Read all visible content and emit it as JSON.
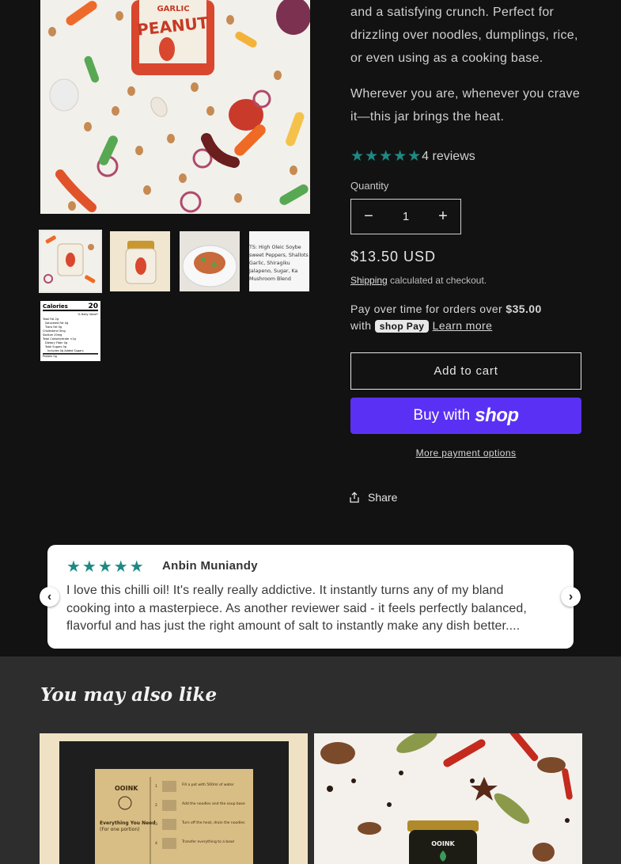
{
  "gallery": {
    "main_alt_text_on_jar_top": "GARLIC",
    "main_alt_text_on_jar": "PEANUT",
    "thumb4_text": "TS: High Oleic Soybe... sweet Peppers, Shallots, Garlic, Shiragiku Jalapeno, Sugar, Ka... Mushroom Blend",
    "nutrition": {
      "heading": "Calories",
      "calories": "20",
      "dv": "% Daily Value*",
      "rows": [
        "Total Fat 2g",
        "Saturated Fat 0g",
        "Trans Fat 0g",
        "Cholesterol 0mg",
        "Sodium 20mg",
        "Total Carbohydrate <1g",
        "Dietary Fiber 0g",
        "Total Sugars 0g",
        "Includes 0g Added Sugars",
        "Protein 0g"
      ]
    }
  },
  "product": {
    "desc_1": "and a satisfying crunch.  Perfect for drizzling over noodles, dumplings, rice, or even using as a cooking base.",
    "desc_2": "Wherever you are, whenever you crave it—this jar brings the heat.",
    "rating_stars": "★★★★★",
    "reviews_count": "4 reviews",
    "quantity_label": "Quantity",
    "quantity_value": "1",
    "decrease_icon": "minus-icon",
    "increase_icon": "plus-icon",
    "price": "$13.50 USD",
    "shipping_link": "Shipping",
    "shipping_rest": " calculated at checkout.",
    "installments_prefix": "Pay over time for orders over ",
    "installments_amount": "$35.00",
    "installments_with": "with",
    "shop_pay_label": "shop Pay",
    "learn_more": "Learn more",
    "add_to_cart": "Add to cart",
    "buy_with": "Buy with",
    "shop_logo": "shop",
    "more_payment": "More payment options",
    "share": "Share",
    "share_icon": "share-icon"
  },
  "review": {
    "stars": "★★★★★",
    "author": "Anbin Muniandy",
    "text": "I love this chilli oil! It's really really addictive. It instantly turns any of my bland cooking into a masterpiece. As another reviewer said - it feels perfectly balanced, flavorful and has just the right amount of salt to instantly make any dish better....",
    "prev_icon": "chevron-left-icon",
    "next_icon": "chevron-right-icon"
  },
  "recommendations": {
    "title": "You may also like",
    "card1": {
      "brand": "OOINK",
      "heading": "Everything You Need (For one portion)",
      "steps": [
        "Fill a pot with 500ml of water and bring to a boil.",
        "Add the noodles and the soup base. Boil for 4 minutes.",
        "Turn off the heat, drain the noodles.",
        "Transfer everything to a bowl. Sprinkle with seasoning."
      ]
    },
    "card2": {
      "brand": "OOINK"
    }
  },
  "colors": {
    "background": "#121212",
    "accent_teal": "#1d8a83",
    "shop_pay": "#5a31f4",
    "reco_bg": "#2d2d2d"
  }
}
